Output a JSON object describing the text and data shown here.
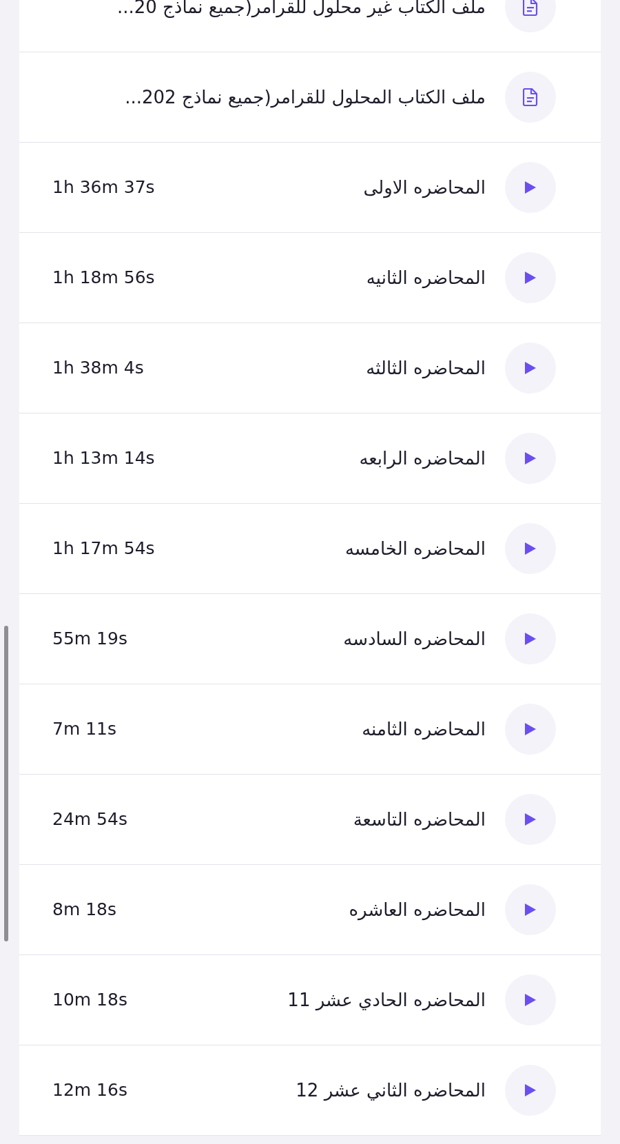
{
  "items": [
    {
      "kind": "file",
      "title": "ملف الكتاب غير محلول للقرامر(جميع نماذج 20..."
    },
    {
      "kind": "file",
      "title": "ملف الكتاب المحلول للقرامر(جميع نماذج 202..."
    },
    {
      "kind": "video",
      "title": "المحاضره الاولى",
      "duration": "1h 36m 37s"
    },
    {
      "kind": "video",
      "title": "المحاضره الثانيه",
      "duration": "1h 18m 56s"
    },
    {
      "kind": "video",
      "title": "المحاضره الثالثه",
      "duration": "1h 38m 4s"
    },
    {
      "kind": "video",
      "title": "المحاضره الرابعه",
      "duration": "1h 13m 14s"
    },
    {
      "kind": "video",
      "title": "المحاضره الخامسه",
      "duration": "1h 17m 54s"
    },
    {
      "kind": "video",
      "title": "المحاضره السادسه",
      "duration": "55m 19s"
    },
    {
      "kind": "video",
      "title": "المحاضره الثامنه",
      "duration": "7m 11s"
    },
    {
      "kind": "video",
      "title": "المحاضره التاسعة",
      "duration": "24m 54s"
    },
    {
      "kind": "video",
      "title": "المحاضره العاشره",
      "duration": "8m 18s"
    },
    {
      "kind": "video",
      "title": "المحاضره الحادي عشر 11",
      "duration": "10m 18s"
    },
    {
      "kind": "video",
      "title": "المحاضره الثاني عشر 12",
      "duration": "12m 16s"
    }
  ]
}
